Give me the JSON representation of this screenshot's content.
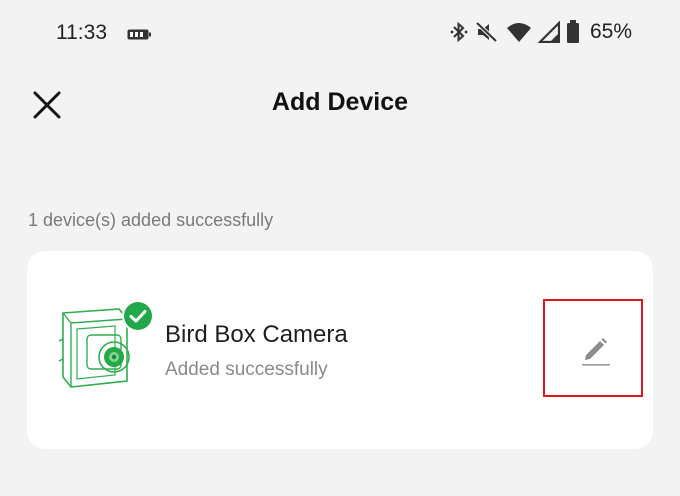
{
  "status_bar": {
    "time": "11:33",
    "battery_percent": "65%",
    "icons": [
      "battery-saver-icon",
      "bluetooth-icon",
      "mute-icon",
      "wifi-icon",
      "signal-icon",
      "battery-icon"
    ]
  },
  "header": {
    "title": "Add Device",
    "close_icon": "close-icon"
  },
  "summary": {
    "text": "1 device(s) added successfully"
  },
  "device": {
    "name": "Bird Box Camera",
    "status": "Added successfully",
    "edit_icon": "pencil-icon"
  },
  "colors": {
    "background": "#f3f3f3",
    "card": "#ffffff",
    "success_green": "#22a848",
    "highlight_red": "#e0141e"
  }
}
